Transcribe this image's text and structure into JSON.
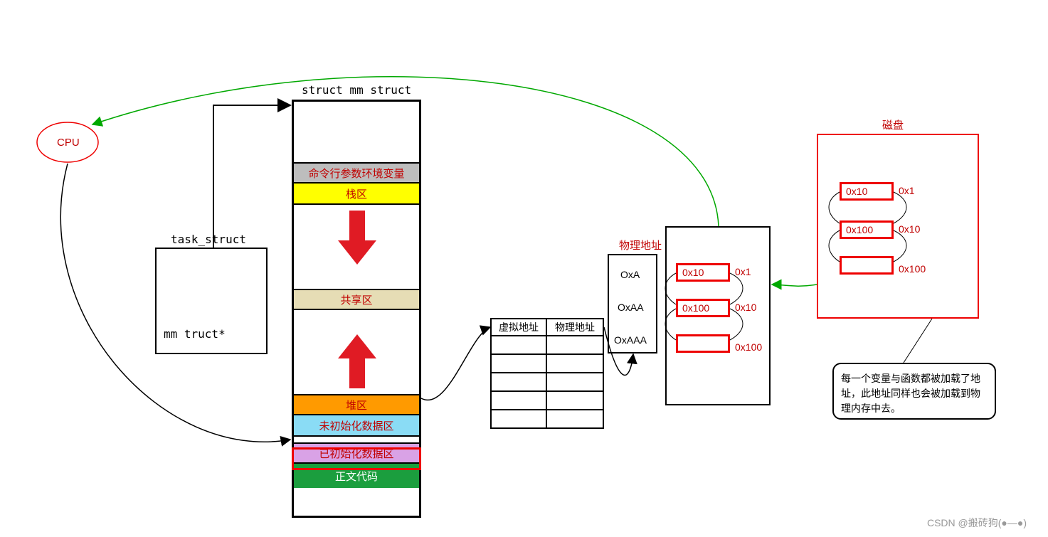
{
  "cpu": {
    "label": "CPU"
  },
  "task_struct": {
    "title": "task_struct",
    "field": "mm truct*"
  },
  "mm_struct": {
    "title": "struct mm struct",
    "segments": {
      "env": "命令行参数环境变量",
      "stack": "栈区",
      "shared": "共享区",
      "heap": "堆区",
      "bss": "未初始化数据区",
      "data": "已初始化数据区",
      "text": "正文代码"
    }
  },
  "page_table": {
    "headers": {
      "virt": "虚拟地址",
      "phys": "物理地址"
    }
  },
  "phys_mem": {
    "title": "物理地址",
    "entries": [
      "OxA",
      "OxAA",
      "OxAAA"
    ],
    "boxes": [
      {
        "val": "0x10",
        "side": "0x1"
      },
      {
        "val": "0x100",
        "side": "0x10"
      },
      {
        "val": "",
        "side": "0x100"
      }
    ]
  },
  "disk": {
    "title": "磁盘",
    "boxes": [
      {
        "val": "0x10",
        "side": "0x1"
      },
      {
        "val": "0x100",
        "side": "0x10"
      },
      {
        "val": "",
        "side": "0x100"
      }
    ]
  },
  "annotation": "每一个变量与函数都被加载了地址，此地址同样也会被加载到物理内存中去。",
  "watermark": "CSDN @搬砖狗(●—●)"
}
